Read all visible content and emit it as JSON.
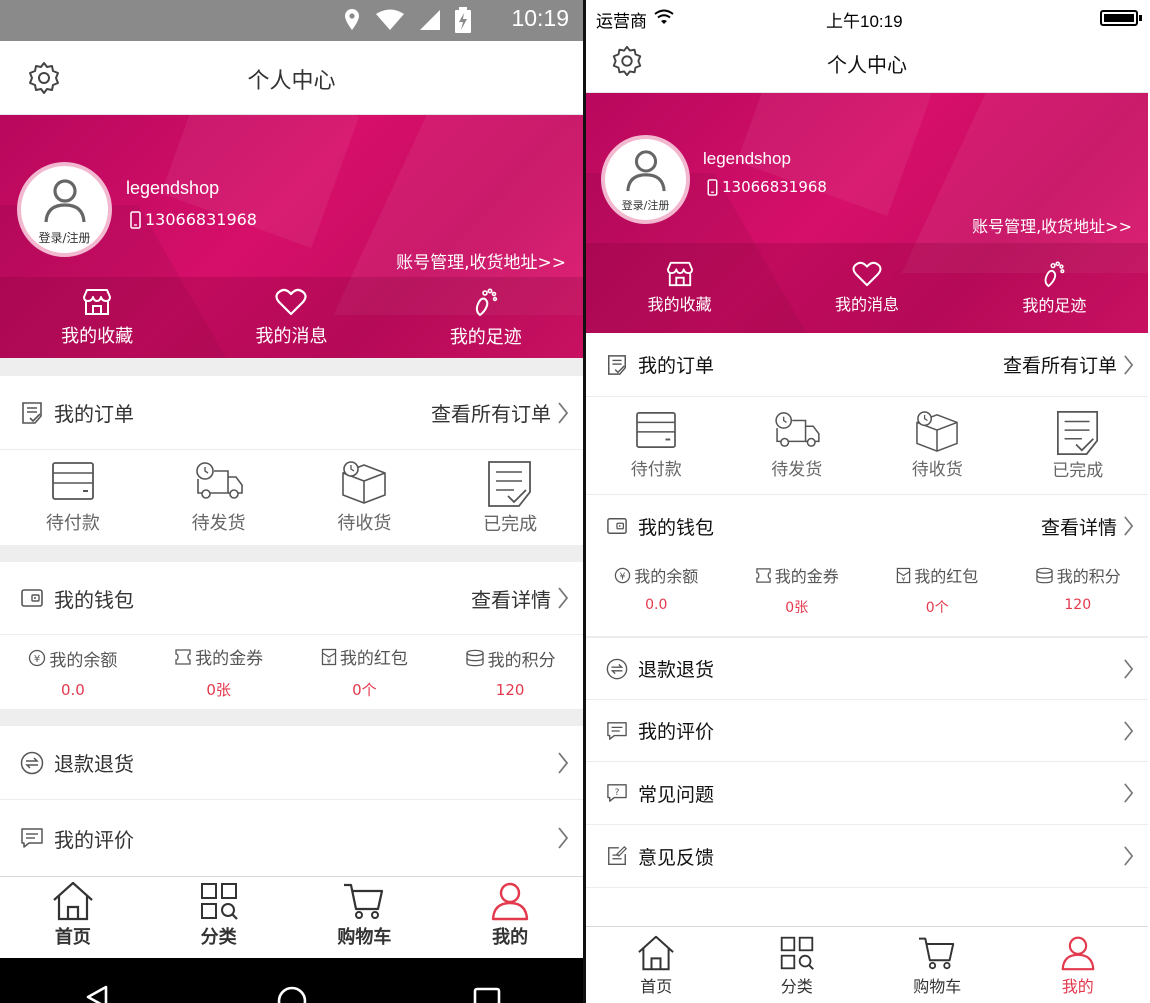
{
  "colors": {
    "brand": "#d1105f",
    "accent_red": "#e3394d",
    "text": "#333333",
    "gray_bg": "#eeeeee"
  },
  "android": {
    "status": {
      "time": "10:19"
    },
    "header": {
      "title": "个人中心"
    },
    "profile": {
      "avatar_label": "登录/注册",
      "username": "legendshop",
      "phone": "13066831968",
      "account_link": "账号管理,收货地址>>"
    },
    "quick": [
      {
        "label": "我的收藏",
        "icon": "store-icon"
      },
      {
        "label": "我的消息",
        "icon": "heart-icon"
      },
      {
        "label": "我的足迹",
        "icon": "footprint-icon"
      }
    ],
    "orders": {
      "title": "我的订单",
      "link": "查看所有订单",
      "items": [
        {
          "label": "待付款"
        },
        {
          "label": "待发货"
        },
        {
          "label": "待收货"
        },
        {
          "label": "已完成"
        }
      ]
    },
    "wallet": {
      "title": "我的钱包",
      "link": "查看详情",
      "items": [
        {
          "label": "我的余额",
          "value": "0.0"
        },
        {
          "label": "我的金券",
          "value": "0张"
        },
        {
          "label": "我的红包",
          "value": "0个"
        },
        {
          "label": "我的积分",
          "value": "120"
        }
      ]
    },
    "menu": [
      {
        "label": "退款退货"
      },
      {
        "label": "我的评价"
      }
    ],
    "tabs": [
      {
        "label": "首页"
      },
      {
        "label": "分类"
      },
      {
        "label": "购物车"
      },
      {
        "label": "我的"
      }
    ]
  },
  "ios": {
    "status": {
      "carrier": "运营商",
      "time": "上午10:19"
    },
    "header": {
      "title": "个人中心"
    },
    "profile": {
      "avatar_label": "登录/注册",
      "username": "legendshop",
      "phone": "13066831968",
      "account_link": "账号管理,收货地址>>"
    },
    "quick": [
      {
        "label": "我的收藏"
      },
      {
        "label": "我的消息"
      },
      {
        "label": "我的足迹"
      }
    ],
    "orders": {
      "title": "我的订单",
      "link": "查看所有订单",
      "items": [
        {
          "label": "待付款"
        },
        {
          "label": "待发货"
        },
        {
          "label": "待收货"
        },
        {
          "label": "已完成"
        }
      ]
    },
    "wallet": {
      "title": "我的钱包",
      "link": "查看详情",
      "items": [
        {
          "label": "我的余额",
          "value": "0.0"
        },
        {
          "label": "我的金券",
          "value": "0张"
        },
        {
          "label": "我的红包",
          "value": "0个"
        },
        {
          "label": "我的积分",
          "value": "120"
        }
      ]
    },
    "menu": [
      {
        "label": "退款退货"
      },
      {
        "label": "我的评价"
      },
      {
        "label": "常见问题"
      },
      {
        "label": "意见反馈"
      }
    ],
    "tabs": [
      {
        "label": "首页"
      },
      {
        "label": "分类"
      },
      {
        "label": "购物车"
      },
      {
        "label": "我的"
      }
    ]
  }
}
